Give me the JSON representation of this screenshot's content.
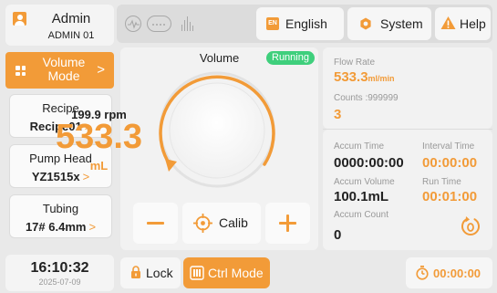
{
  "sidebar": {
    "user": {
      "name": "Admin",
      "id": "ADMIN 01"
    },
    "mode": {
      "line1": "Volume",
      "line2": "Mode",
      "arrow": ">"
    },
    "recipe": {
      "label": "Recipe",
      "value": "Recipe01"
    },
    "pump_head": {
      "label": "Pump Head",
      "value": "YZ1515x"
    },
    "tubing": {
      "label": "Tubing",
      "value": "17# 6.4mm"
    },
    "chevron": ">",
    "clock": {
      "time": "16:10:32",
      "date": "2025-07-09"
    }
  },
  "topbar": {
    "language_badge": "EN",
    "language_label": "English",
    "system_label": "System",
    "help_label": "Help"
  },
  "volume_panel": {
    "title": "Volume",
    "status": "Running",
    "speed": "199.9 rpm",
    "value": "533.3",
    "unit": "mL",
    "calib_label": "Calib"
  },
  "info": {
    "flow_rate_label": "Flow Rate",
    "flow_rate_value": "533.3",
    "flow_rate_unit": "ml/min",
    "counts_label": "Counts :999999",
    "counts_value": "3",
    "accum_time_label": "Accum  Time",
    "accum_time_value": "0000:00:00",
    "interval_time_label": "Interval Time",
    "interval_time_value": "00:00:00",
    "accum_volume_label": "Accum Volume",
    "accum_volume_value": "100.1mL",
    "run_time_label": "Run Time",
    "run_time_value": "00:01:00",
    "accum_count_label": "Accum Count",
    "accum_count_value": "0"
  },
  "bottom": {
    "lock_label": "Lock",
    "ctrl_mode_label": "Ctrl Mode",
    "timer_value": "00:00:00"
  },
  "colors": {
    "accent": "#f29b38",
    "running": "#3fcf7c",
    "background": "#e9e9e9",
    "panel": "#f2f2f2"
  },
  "icons": [
    "user-icon",
    "grid-icon",
    "chevron-right-icon",
    "pulse-icon",
    "dots-icon",
    "bars-icon",
    "gear-icon",
    "warning-icon",
    "target-icon",
    "minus-icon",
    "plus-icon",
    "reset-icon",
    "lock-icon",
    "ctrl-mode-icon",
    "timer-icon"
  ]
}
